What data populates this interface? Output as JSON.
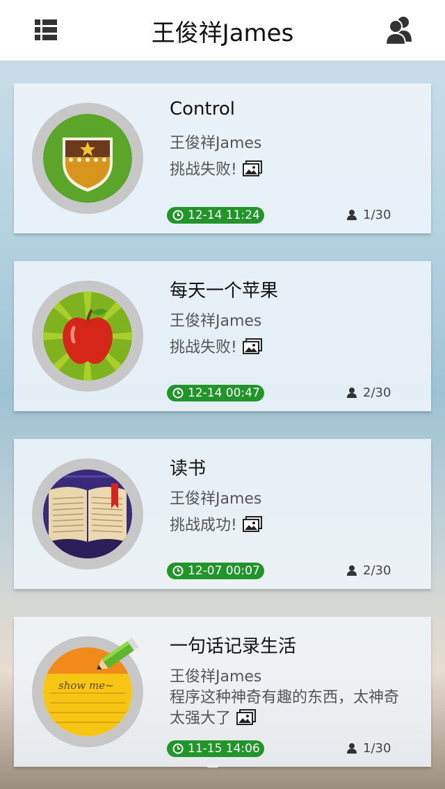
{
  "header": {
    "title": "王俊祥James",
    "menu_icon": "list-menu-icon",
    "profile_icon": "user-group-icon"
  },
  "cards": [
    {
      "title": "Control",
      "user": "王俊祥James",
      "status": "挑战失败!",
      "time": "12-14 11:24",
      "count": "1/30",
      "avatar": "badge-shield-icon"
    },
    {
      "title": "每天一个苹果",
      "user": "王俊祥James",
      "status": "挑战失败!",
      "time": "12-14 00:47",
      "count": "2/30",
      "avatar": "apple-icon"
    },
    {
      "title": "读书",
      "user": "王俊祥James",
      "status": "挑战成功!",
      "time": "12-07 00:07",
      "count": "2/30",
      "avatar": "open-book-icon"
    },
    {
      "title": "一句话记录生活",
      "user": "王俊祥James",
      "status": "程序这种神奇有趣的东西，太神奇太强大了",
      "time": "11-15 14:06",
      "count": "1/30",
      "avatar": "note-pencil-icon",
      "note_text": "show me~"
    }
  ],
  "colors": {
    "badge_green": "#21952a",
    "header_bg": "#ffffff",
    "avatar_ring": "#c7c7c7"
  }
}
